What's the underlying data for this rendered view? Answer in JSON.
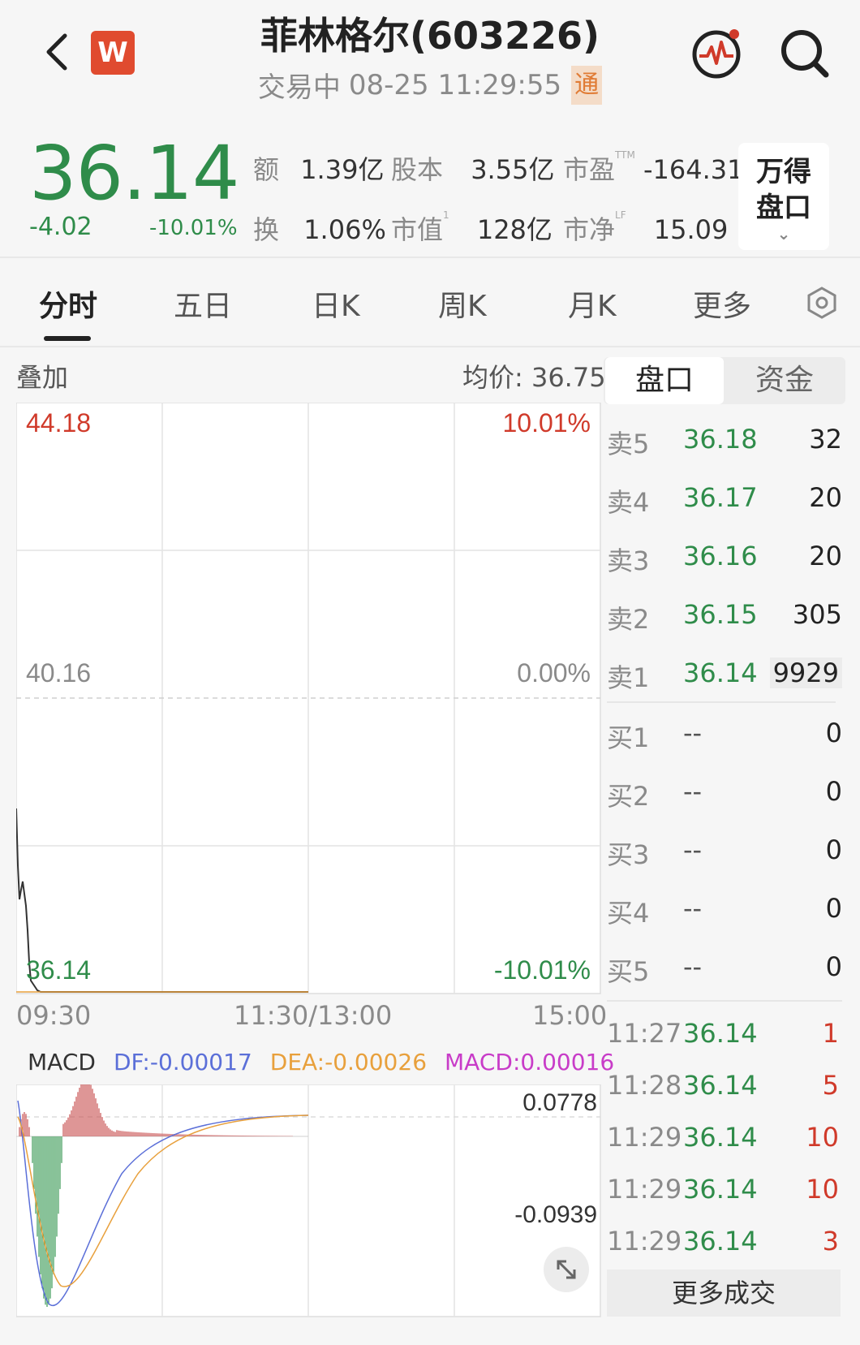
{
  "header": {
    "title": "菲林格尔(603226)",
    "status": "交易中",
    "datetime": "08-25 11:29:55",
    "tong_badge": "通",
    "app_logo": "W"
  },
  "quote": {
    "price": "36.14",
    "change": "-4.02",
    "change_pct": "-10.01%",
    "stats": [
      {
        "label": "额",
        "sup": "",
        "value": "1.39亿"
      },
      {
        "label": "股本",
        "sup": "",
        "value": "3.55亿"
      },
      {
        "label": "市盈",
        "sup": "TTM",
        "value": "-164.31"
      },
      {
        "label": "换",
        "sup": "",
        "value": "1.06%"
      },
      {
        "label": "市值",
        "sup": "1",
        "value": "128亿"
      },
      {
        "label": "市净",
        "sup": "LF",
        "value": "15.09"
      }
    ],
    "wind_button": {
      "line1": "万得",
      "line2": "盘口"
    }
  },
  "tabs": [
    "分时",
    "五日",
    "日K",
    "周K",
    "月K",
    "更多"
  ],
  "chart": {
    "overlay_label": "叠加",
    "avg_price_label": "均价: 36.75",
    "top_price": "44.18",
    "mid_price": "40.16",
    "bottom_price": "36.14",
    "top_pct": "10.01%",
    "mid_pct": "0.00%",
    "bottom_pct": "-10.01%",
    "time_start": "09:30",
    "time_mid": "11:30/13:00",
    "time_end": "15:00"
  },
  "macd": {
    "name": "MACD",
    "df": "DF:-0.00017",
    "dea": "DEA:-0.00026",
    "macd": "MACD:0.00016",
    "top_value": "0.0778",
    "bottom_value": "-0.0939",
    "colors": {
      "df": "#5b6fd8",
      "dea": "#e8a03c",
      "macd": "#c83cc8"
    }
  },
  "order_book": {
    "tabs": [
      "盘口",
      "资金"
    ],
    "asks": [
      {
        "label": "卖5",
        "price": "36.18",
        "volume": "32"
      },
      {
        "label": "卖4",
        "price": "36.17",
        "volume": "20"
      },
      {
        "label": "卖3",
        "price": "36.16",
        "volume": "20"
      },
      {
        "label": "卖2",
        "price": "36.15",
        "volume": "305"
      },
      {
        "label": "卖1",
        "price": "36.14",
        "volume": "9929"
      }
    ],
    "bids": [
      {
        "label": "买1",
        "price": "--",
        "volume": "0"
      },
      {
        "label": "买2",
        "price": "--",
        "volume": "0"
      },
      {
        "label": "买3",
        "price": "--",
        "volume": "0"
      },
      {
        "label": "买4",
        "price": "--",
        "volume": "0"
      },
      {
        "label": "买5",
        "price": "--",
        "volume": "0"
      }
    ],
    "trades": [
      {
        "time": "11:27",
        "price": "36.14",
        "qty": "1"
      },
      {
        "time": "11:28",
        "price": "36.14",
        "qty": "5"
      },
      {
        "time": "11:29",
        "price": "36.14",
        "qty": "10"
      },
      {
        "time": "11:29",
        "price": "36.14",
        "qty": "10"
      },
      {
        "time": "11:29",
        "price": "36.14",
        "qty": "3"
      }
    ],
    "more_trades": "更多成交"
  },
  "colors": {
    "down": "#2f8c4a",
    "up": "#d03a2a",
    "accent": "#e04b2f"
  }
}
